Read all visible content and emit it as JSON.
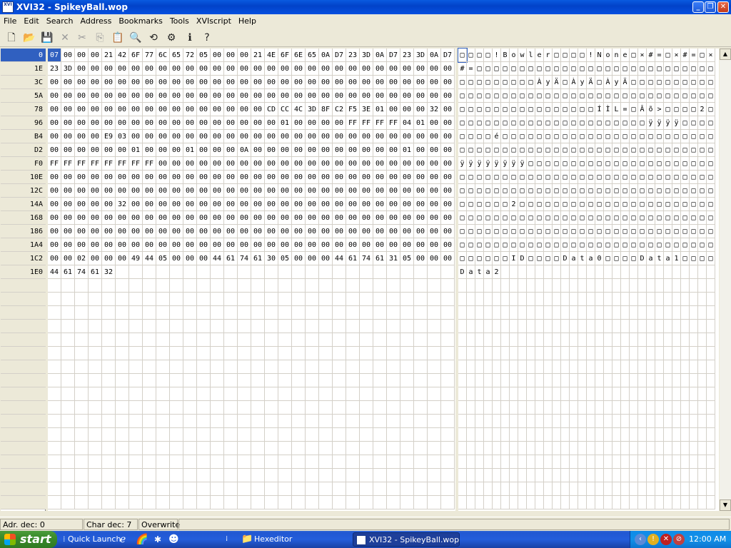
{
  "window": {
    "title": "XVI32 - SpikeyBall.wop",
    "app_icon_text": "XVI"
  },
  "menu": [
    "File",
    "Edit",
    "Search",
    "Address",
    "Bookmarks",
    "Tools",
    "XVIscript",
    "Help"
  ],
  "toolbar_icons": [
    {
      "name": "new-file-icon",
      "glyph": "🗋",
      "enabled": true
    },
    {
      "name": "open-folder-icon",
      "glyph": "📂",
      "enabled": true
    },
    {
      "name": "save-icon",
      "glyph": "💾",
      "enabled": true
    },
    {
      "name": "close-x-icon",
      "glyph": "✕",
      "enabled": false
    },
    {
      "name": "cut-icon",
      "glyph": "✂",
      "enabled": false
    },
    {
      "name": "copy-icon",
      "glyph": "⎘",
      "enabled": false
    },
    {
      "name": "paste-icon",
      "glyph": "📋",
      "enabled": false
    },
    {
      "name": "search-icon",
      "glyph": "🔍",
      "enabled": true
    },
    {
      "name": "search-replace-icon",
      "glyph": "⟲",
      "enabled": true
    },
    {
      "name": "properties-icon",
      "glyph": "⚙",
      "enabled": true
    },
    {
      "name": "info-icon",
      "glyph": "ℹ",
      "enabled": true
    },
    {
      "name": "help-pointer-icon",
      "glyph": "?",
      "enabled": true
    }
  ],
  "hex": {
    "addresses": [
      "0",
      "1E",
      "3C",
      "5A",
      "78",
      "96",
      "B4",
      "D2",
      "F0",
      "10E",
      "12C",
      "14A",
      "168",
      "186",
      "1A4",
      "1C2",
      "1E0"
    ],
    "rows": [
      [
        "07",
        "00",
        "00",
        "00",
        "21",
        "42",
        "6F",
        "77",
        "6C",
        "65",
        "72",
        "05",
        "00",
        "00",
        "00",
        "21",
        "4E",
        "6F",
        "6E",
        "65",
        "0A",
        "D7",
        "23",
        "3D",
        "0A",
        "D7",
        "23",
        "3D",
        "0A",
        "D7"
      ],
      [
        "23",
        "3D",
        "00",
        "00",
        "00",
        "00",
        "00",
        "00",
        "00",
        "00",
        "00",
        "00",
        "00",
        "00",
        "00",
        "00",
        "00",
        "00",
        "00",
        "00",
        "00",
        "00",
        "00",
        "00",
        "00",
        "00",
        "00",
        "00",
        "00",
        "00"
      ],
      [
        "00",
        "00",
        "00",
        "00",
        "00",
        "00",
        "00",
        "00",
        "00",
        "00",
        "00",
        "00",
        "00",
        "00",
        "00",
        "00",
        "00",
        "00",
        "00",
        "00",
        "00",
        "00",
        "00",
        "00",
        "00",
        "00",
        "00",
        "00",
        "00",
        "00"
      ],
      [
        "00",
        "00",
        "00",
        "00",
        "00",
        "00",
        "00",
        "00",
        "00",
        "00",
        "00",
        "00",
        "00",
        "00",
        "00",
        "00",
        "00",
        "00",
        "00",
        "00",
        "00",
        "00",
        "00",
        "00",
        "00",
        "00",
        "00",
        "00",
        "00",
        "00"
      ],
      [
        "00",
        "00",
        "00",
        "00",
        "00",
        "00",
        "00",
        "00",
        "00",
        "00",
        "00",
        "00",
        "00",
        "00",
        "00",
        "00",
        "CD",
        "CC",
        "4C",
        "3D",
        "8F",
        "C2",
        "F5",
        "3E",
        "01",
        "00",
        "00",
        "00",
        "32",
        "00"
      ],
      [
        "00",
        "00",
        "00",
        "00",
        "00",
        "00",
        "00",
        "00",
        "00",
        "00",
        "00",
        "00",
        "00",
        "00",
        "00",
        "00",
        "00",
        "01",
        "00",
        "00",
        "00",
        "00",
        "FF",
        "FF",
        "FF",
        "FF",
        "04",
        "01",
        "00",
        "00"
      ],
      [
        "00",
        "00",
        "00",
        "00",
        "E9",
        "03",
        "00",
        "00",
        "00",
        "00",
        "00",
        "00",
        "00",
        "00",
        "00",
        "00",
        "00",
        "00",
        "00",
        "00",
        "00",
        "00",
        "00",
        "00",
        "00",
        "00",
        "00",
        "00",
        "00",
        "00"
      ],
      [
        "00",
        "00",
        "00",
        "00",
        "00",
        "00",
        "01",
        "00",
        "00",
        "00",
        "01",
        "00",
        "00",
        "00",
        "0A",
        "00",
        "00",
        "00",
        "00",
        "00",
        "00",
        "00",
        "00",
        "00",
        "00",
        "00",
        "01",
        "00",
        "00",
        "00"
      ],
      [
        "FF",
        "FF",
        "FF",
        "FF",
        "FF",
        "FF",
        "FF",
        "FF",
        "00",
        "00",
        "00",
        "00",
        "00",
        "00",
        "00",
        "00",
        "00",
        "00",
        "00",
        "00",
        "00",
        "00",
        "00",
        "00",
        "00",
        "00",
        "00",
        "00",
        "00",
        "00"
      ],
      [
        "00",
        "00",
        "00",
        "00",
        "00",
        "00",
        "00",
        "00",
        "00",
        "00",
        "00",
        "00",
        "00",
        "00",
        "00",
        "00",
        "00",
        "00",
        "00",
        "00",
        "00",
        "00",
        "00",
        "00",
        "00",
        "00",
        "00",
        "00",
        "00",
        "00"
      ],
      [
        "00",
        "00",
        "00",
        "00",
        "00",
        "00",
        "00",
        "00",
        "00",
        "00",
        "00",
        "00",
        "00",
        "00",
        "00",
        "00",
        "00",
        "00",
        "00",
        "00",
        "00",
        "00",
        "00",
        "00",
        "00",
        "00",
        "00",
        "00",
        "00",
        "00"
      ],
      [
        "00",
        "00",
        "00",
        "00",
        "00",
        "32",
        "00",
        "00",
        "00",
        "00",
        "00",
        "00",
        "00",
        "00",
        "00",
        "00",
        "00",
        "00",
        "00",
        "00",
        "00",
        "00",
        "00",
        "00",
        "00",
        "00",
        "00",
        "00",
        "00",
        "00"
      ],
      [
        "00",
        "00",
        "00",
        "00",
        "00",
        "00",
        "00",
        "00",
        "00",
        "00",
        "00",
        "00",
        "00",
        "00",
        "00",
        "00",
        "00",
        "00",
        "00",
        "00",
        "00",
        "00",
        "00",
        "00",
        "00",
        "00",
        "00",
        "00",
        "00",
        "00"
      ],
      [
        "00",
        "00",
        "00",
        "00",
        "00",
        "00",
        "00",
        "00",
        "00",
        "00",
        "00",
        "00",
        "00",
        "00",
        "00",
        "00",
        "00",
        "00",
        "00",
        "00",
        "00",
        "00",
        "00",
        "00",
        "00",
        "00",
        "00",
        "00",
        "00",
        "00"
      ],
      [
        "00",
        "00",
        "00",
        "00",
        "00",
        "00",
        "00",
        "00",
        "00",
        "00",
        "00",
        "00",
        "00",
        "00",
        "00",
        "00",
        "00",
        "00",
        "00",
        "00",
        "00",
        "00",
        "00",
        "00",
        "00",
        "00",
        "00",
        "00",
        "00",
        "00"
      ],
      [
        "00",
        "00",
        "02",
        "00",
        "00",
        "00",
        "49",
        "44",
        "05",
        "00",
        "00",
        "00",
        "44",
        "61",
        "74",
        "61",
        "30",
        "05",
        "00",
        "00",
        "00",
        "44",
        "61",
        "74",
        "61",
        "31",
        "05",
        "00",
        "00",
        "00"
      ],
      [
        "44",
        "61",
        "74",
        "61",
        "32"
      ]
    ],
    "text_rows": [
      "□□□□!Bowler□□□□!None□×#=□×#=□×",
      "#=□□□□□□□□□□□□□□□□□□□□□□□□□□□□",
      "□□□□□□□□□ÀyÄ□ÀyÄ□ÀyÄ□□□□□□□□□□",
      "□□□□□□□□□□□□□□□□□□□□□□□□□□□□□□",
      "□□□□□□□□□□□□□□□□ÍÌL=□Âõ>□□□□2□",
      "□□□□□□□□□□□□□□□□□□□□□□ÿÿÿÿ□□□□",
      "□□□□é□□□□□□□□□□□□□□□□□□□□□□□□□",
      "□□□□□□□□□□□□□□□□□□□□□□□□□□□□□□",
      "ÿÿÿÿÿÿÿÿ□□□□□□□□□□□□□□□□□□□□□□",
      "□□□□□□□□□□□□□□□□□□□□□□□□□□□□□□",
      "□□□□□□□□□□□□□□□□□□□□□□□□□□□□□□",
      "□□□□□□2□□□□□□□□□□□□□□□□□□□□□□□",
      "□□□□□□□□□□□□□□□□□□□□□□□□□□□□□□",
      "□□□□□□□□□□□□□□□□□□□□□□□□□□□□□□",
      "□□□□□□□□□□□□□□□□□□□□□□□□□□□□□□",
      "□□□□□□ID□□□□Data0□□□□Data1□□□□",
      "Data2"
    ]
  },
  "status": {
    "addr": "Adr. dec: 0",
    "char": "Char dec: 7",
    "mode": "Overwrite"
  },
  "taskbar": {
    "start": "start",
    "quick_launch": "Quick Launch",
    "folder_button": "Hexeditor",
    "active_button": "XVI32 - SpikeyBall.wop",
    "clock": "12:00 AM"
  }
}
